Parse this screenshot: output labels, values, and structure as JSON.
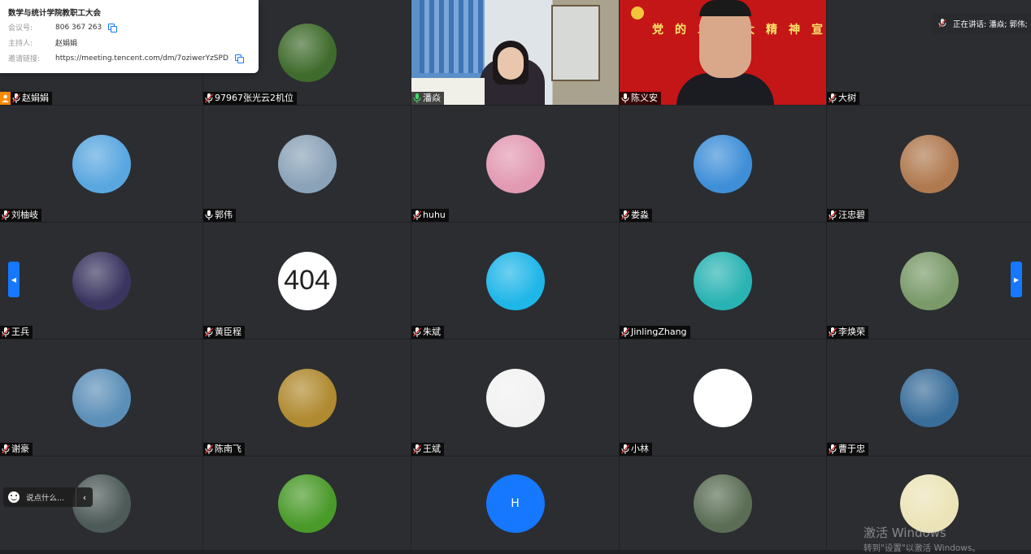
{
  "meeting_info": {
    "title": "数学与统计学院教职工大会",
    "rows": [
      {
        "key": "会议号:",
        "value": "806 367 263",
        "copy": true
      },
      {
        "key": "主持人:",
        "value": "赵娟娟",
        "copy": false
      },
      {
        "key": "邀请链接:",
        "value": "https://meeting.tencent.com/dm/7oziwerYzSPD",
        "copy": true
      }
    ]
  },
  "speaking_now": "正在讲话: 潘焱; 郭伟;",
  "video_banner_text": "党的二十大精神宣讲",
  "chat": {
    "placeholder": "说点什么..."
  },
  "watermark": {
    "line1": "激活 Windows",
    "line2": "转到\"设置\"以激活 Windows。"
  },
  "participants": [
    {
      "name": "赵娟娟",
      "type": "blank",
      "mic": "muted",
      "host": true
    },
    {
      "name": "97967张光云2机位",
      "type": "avatar",
      "avatar_icon": "green-leaves-avatar",
      "color": "#3f6b2c",
      "mic": "muted"
    },
    {
      "name": "潘焱",
      "type": "video",
      "video_icon": "woman-office-video",
      "mic": "active"
    },
    {
      "name": "陈义安",
      "type": "video",
      "video_icon": "man-red-banner-video",
      "mic": "on"
    },
    {
      "name": "大树",
      "type": "blank",
      "mic": "muted"
    },
    {
      "name": "刘柚岐",
      "type": "avatar",
      "avatar_icon": "blue-sky-cloud-avatar",
      "color": "#5aa7e0",
      "mic": "muted"
    },
    {
      "name": "郭伟",
      "type": "avatar",
      "avatar_icon": "mountain-lake-avatar",
      "color": "#8ba3b8",
      "mic": "on"
    },
    {
      "name": "huhu",
      "type": "avatar",
      "avatar_icon": "flower-bouquet-avatar",
      "color": "#e29ab3",
      "mic": "muted"
    },
    {
      "name": "娄淼",
      "type": "avatar",
      "avatar_icon": "daisy-sky-avatar",
      "color": "#3f8fd8",
      "mic": "muted"
    },
    {
      "name": "汪忠碧",
      "type": "avatar",
      "avatar_icon": "child-portrait-avatar",
      "color": "#b07a50",
      "mic": "muted"
    },
    {
      "name": "王兵",
      "type": "avatar",
      "avatar_icon": "night-child-avatar",
      "color": "#3a3560",
      "mic": "muted"
    },
    {
      "name": "黄臣程",
      "type": "text404",
      "avatar_text": "404",
      "mic": "muted"
    },
    {
      "name": "朱斌",
      "type": "avatar",
      "avatar_icon": "young-man-avatar",
      "color": "#1fb6e8",
      "mic": "muted"
    },
    {
      "name": "JinlingZhang",
      "type": "avatar",
      "avatar_icon": "santa-hat-avatar",
      "color": "#2ab3b3",
      "mic": "muted"
    },
    {
      "name": "李焕荣",
      "type": "avatar",
      "avatar_icon": "two-children-avatar",
      "color": "#7a9a6a",
      "mic": "muted"
    },
    {
      "name": "谢豪",
      "type": "avatar",
      "avatar_icon": "mountain-lake-avatar",
      "color": "#5c8fb8",
      "mic": "muted"
    },
    {
      "name": "陈南飞",
      "type": "avatar",
      "avatar_icon": "autumn-trees-avatar",
      "color": "#b08a30",
      "mic": "muted"
    },
    {
      "name": "王斌",
      "type": "avatar",
      "avatar_icon": "vintage-car-sketch-avatar",
      "color": "#f2f2f2",
      "mic": "muted"
    },
    {
      "name": "小林",
      "type": "avatar",
      "avatar_icon": "sketch-face-avatar",
      "color": "#ffffff",
      "mic": "muted"
    },
    {
      "name": "曹于忠",
      "type": "avatar",
      "avatar_icon": "bridge-night-avatar",
      "color": "#3a6e9a",
      "mic": "muted"
    },
    {
      "name": "",
      "type": "avatar",
      "avatar_icon": "city-towers-avatar",
      "color": "#4d5a58",
      "mic": "none"
    },
    {
      "name": "",
      "type": "avatar",
      "avatar_icon": "water-drops-avatar",
      "color": "#4a9a2a",
      "mic": "none"
    },
    {
      "name": "",
      "type": "textH",
      "avatar_text": "H",
      "mic": "none"
    },
    {
      "name": "",
      "type": "avatar",
      "avatar_icon": "aerial-road-avatar",
      "color": "#5b6e55",
      "mic": "none"
    },
    {
      "name": "",
      "type": "avatar",
      "avatar_icon": "girl-poem-avatar",
      "color": "#ece4b8",
      "mic": "none"
    }
  ]
}
